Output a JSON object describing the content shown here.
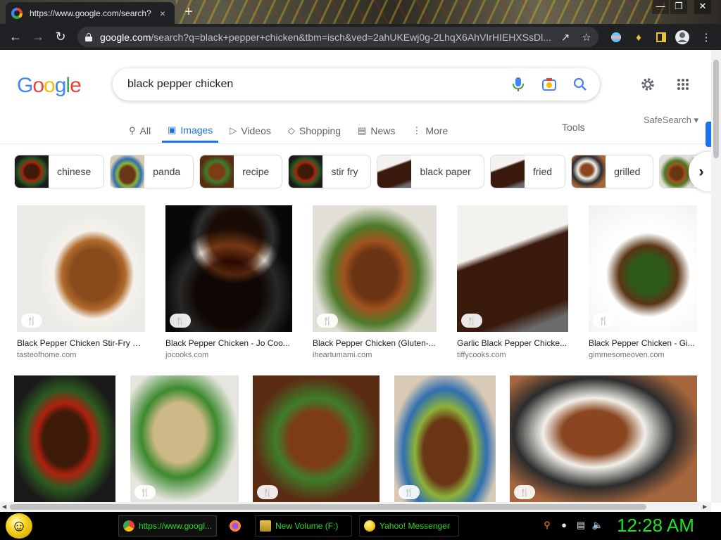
{
  "browser": {
    "tab_title": "https://www.google.com/search?",
    "tab_close": "×",
    "new_tab": "+",
    "window_controls": [
      "—",
      "❐",
      "✕"
    ],
    "url_host": "google.com",
    "url_rest": "/search?q=black+pepper+chicken&tbm=isch&ved=2ahUKEwj0g-2LhqX6AhVIrHIEHXSsDl..."
  },
  "google": {
    "logo_letters": [
      {
        "ch": "G",
        "color": "#4285f4"
      },
      {
        "ch": "o",
        "color": "#ea4335"
      },
      {
        "ch": "o",
        "color": "#fbbc05"
      },
      {
        "ch": "g",
        "color": "#4285f4"
      },
      {
        "ch": "l",
        "color": "#34a853"
      },
      {
        "ch": "e",
        "color": "#ea4335"
      }
    ],
    "query": "black pepper chicken",
    "tabs": [
      {
        "label": "All",
        "icon": "search-icon"
      },
      {
        "label": "Images",
        "icon": "image-icon",
        "active": true
      },
      {
        "label": "Videos",
        "icon": "video-icon"
      },
      {
        "label": "Shopping",
        "icon": "tag-icon"
      },
      {
        "label": "News",
        "icon": "news-icon"
      },
      {
        "label": "More",
        "icon": "more-dots-icon"
      }
    ],
    "tools": "Tools",
    "safesearch": "SafeSearch ▾",
    "chips": [
      "chinese",
      "panda",
      "recipe",
      "stir fry",
      "black paper",
      "fried",
      "grilled"
    ],
    "chip_next": "›",
    "results_row1": [
      {
        "title": "Black Pepper Chicken Stir-Fry R...",
        "source": "tasteofhome.com"
      },
      {
        "title": "Black Pepper Chicken - Jo Coo...",
        "source": "jocooks.com"
      },
      {
        "title": "Black Pepper Chicken (Gluten-...",
        "source": "iheartumami.com"
      },
      {
        "title": "Garlic Black Pepper Chicke...",
        "source": "tiffycooks.com"
      },
      {
        "title": "Black Pepper Chicken - Gi...",
        "source": "gimmesomeoven.com"
      }
    ],
    "recipe_badge": "🍴"
  },
  "taskbar": {
    "tasks": [
      {
        "label": "https://www.googl...",
        "icon_color": "#4285f4"
      },
      {
        "label": "",
        "icon_color": "#ff7139"
      },
      {
        "label": "New Volume (F:)",
        "icon_color": "#e8c24a"
      },
      {
        "label": "Yahoo! Messenger",
        "icon_color": "#f7d21e"
      }
    ],
    "clock": "12:28 AM"
  }
}
